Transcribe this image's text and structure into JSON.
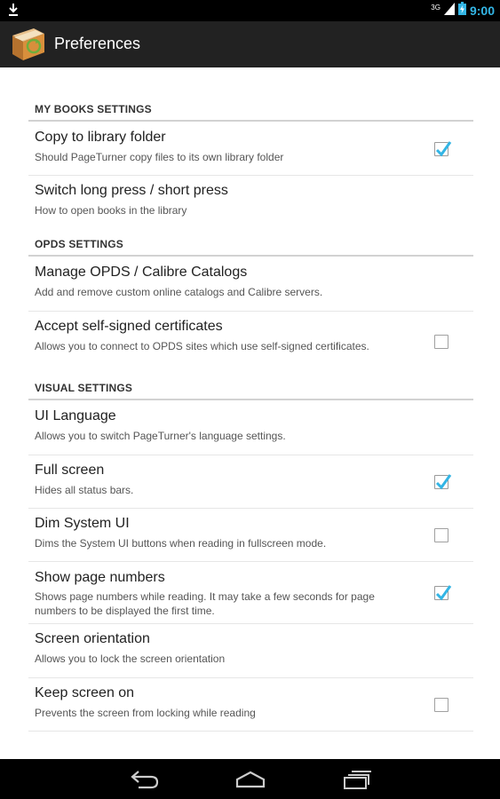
{
  "status_bar": {
    "time": "9:00",
    "signal_label": "3G",
    "icons": [
      "download-icon",
      "signal-icon",
      "battery-icon"
    ],
    "time_color": "#33b5e5"
  },
  "action_bar": {
    "title": "Preferences",
    "app_icon": "pageturner-book-icon"
  },
  "sections": [
    {
      "header": "MY BOOKS SETTINGS",
      "items": [
        {
          "title": "Copy to library folder",
          "summary": "Should PageTurner copy files to its own library folder",
          "checkbox": true
        },
        {
          "title": "Switch long press / short press",
          "summary": "How to open books in the library",
          "checkbox": null
        }
      ]
    },
    {
      "header": "OPDS SETTINGS",
      "items": [
        {
          "title": "Manage OPDS / Calibre Catalogs",
          "summary": "Add and remove custom online catalogs and Calibre servers.",
          "checkbox": null
        },
        {
          "title": "Accept self-signed certificates",
          "summary": "Allows you to connect to OPDS sites which use self-signed certificates.",
          "checkbox": false
        }
      ]
    },
    {
      "header": "VISUAL SETTINGS",
      "items": [
        {
          "title": "UI Language",
          "summary": "Allows you to switch PageTurner's language settings.",
          "checkbox": null
        },
        {
          "title": "Full screen",
          "summary": "Hides all status bars.",
          "checkbox": true
        },
        {
          "title": "Dim System UI",
          "summary": "Dims the System UI buttons when reading in fullscreen mode.",
          "checkbox": false
        },
        {
          "title": "Show page numbers",
          "summary": "Shows page numbers while reading. It may take a few seconds for page numbers to be displayed the first time.",
          "checkbox": true
        },
        {
          "title": "Screen orientation",
          "summary": "Allows you to lock the screen orientation",
          "checkbox": null
        },
        {
          "title": "Keep screen on",
          "summary": "Prevents the screen from locking while reading",
          "checkbox": false
        }
      ]
    }
  ],
  "nav_bar": {
    "buttons": [
      "back-icon",
      "home-icon",
      "recent-apps-icon"
    ]
  },
  "colors": {
    "accent": "#33b5e5",
    "action_bar": "#222222",
    "divider": "#d2d2d2"
  }
}
